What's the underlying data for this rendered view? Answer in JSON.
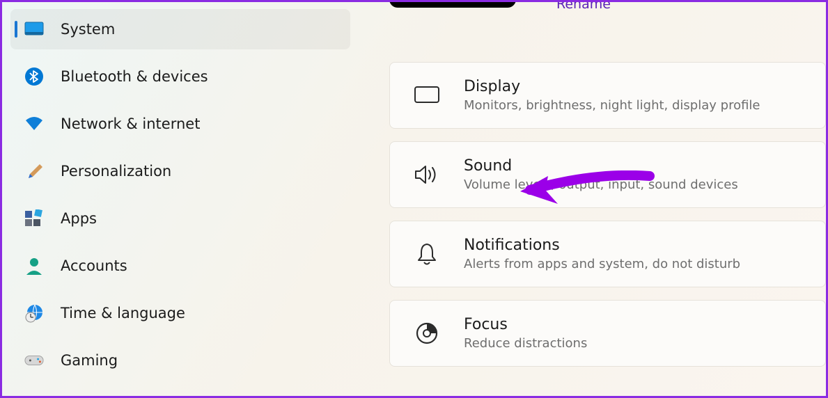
{
  "header": {
    "rename_link": "Rename"
  },
  "sidebar": {
    "items": [
      {
        "label": "System",
        "icon": "monitor-icon",
        "active": true
      },
      {
        "label": "Bluetooth & devices",
        "icon": "bluetooth-icon",
        "active": false
      },
      {
        "label": "Network & internet",
        "icon": "wifi-icon",
        "active": false
      },
      {
        "label": "Personalization",
        "icon": "brush-icon",
        "active": false
      },
      {
        "label": "Apps",
        "icon": "apps-icon",
        "active": false
      },
      {
        "label": "Accounts",
        "icon": "person-icon",
        "active": false
      },
      {
        "label": "Time & language",
        "icon": "globe-clock-icon",
        "active": false
      },
      {
        "label": "Gaming",
        "icon": "gamepad-icon",
        "active": false
      }
    ]
  },
  "main": {
    "cards": [
      {
        "title": "Display",
        "subtitle": "Monitors, brightness, night light, display profile",
        "icon": "display-icon"
      },
      {
        "title": "Sound",
        "subtitle": "Volume levels, output, input, sound devices",
        "icon": "sound-icon"
      },
      {
        "title": "Notifications",
        "subtitle": "Alerts from apps and system, do not disturb",
        "icon": "bell-icon"
      },
      {
        "title": "Focus",
        "subtitle": "Reduce distractions",
        "icon": "focus-icon"
      }
    ]
  },
  "annotation": {
    "arrow_target": "Sound",
    "color": "#9b00e8"
  }
}
